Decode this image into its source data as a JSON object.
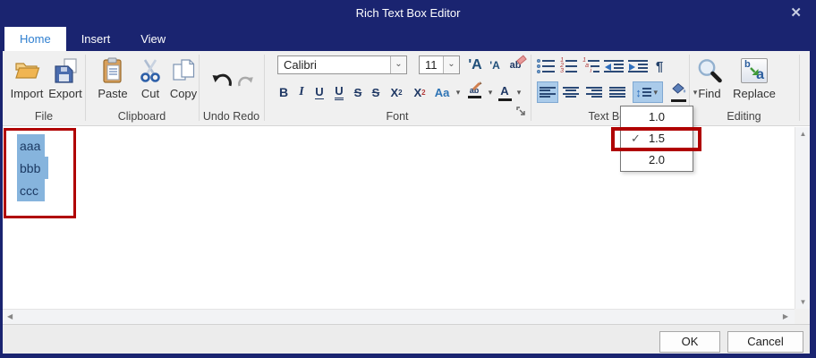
{
  "window": {
    "title": "Rich Text Box Editor"
  },
  "glyphs": {
    "close": "✕",
    "chevron": "⌄",
    "menu_arrow": "▾",
    "check": "✓",
    "up": "▲",
    "down": "▼",
    "left": "◀",
    "right": "▶",
    "updown": "↕",
    "pilcrow": "¶"
  },
  "tabs": {
    "home": "Home",
    "insert": "Insert",
    "view": "View"
  },
  "ribbon": {
    "file": {
      "label": "File",
      "import": "Import",
      "export": "Export"
    },
    "clipboard": {
      "label": "Clipboard",
      "paste": "Paste",
      "cut": "Cut",
      "copy": "Copy"
    },
    "undo_redo": {
      "label": "Undo Redo"
    },
    "font": {
      "label": "Font",
      "family": "Calibri",
      "size": "11",
      "grow": "'A",
      "shrink": "'A",
      "clear": "ab",
      "bold": "B",
      "italic": "I",
      "underline": "U",
      "double_underline": "U",
      "strikethrough": "S",
      "double_strikethrough": "S",
      "sup_base": "X",
      "sup_mark": "2",
      "sub_base": "X",
      "sub_mark": "2",
      "change_case": "Aa",
      "highlight": "ab",
      "font_color": "A"
    },
    "text_box": {
      "label": "Text Box",
      "numbering_marks": [
        "1",
        "2",
        "3"
      ],
      "multilevel_marks": [
        "1",
        "a",
        "i"
      ]
    },
    "editing": {
      "label": "Editing",
      "find": "Find",
      "replace": "Replace",
      "replace_b": "b",
      "replace_a": "a"
    }
  },
  "line_spacing_menu": {
    "items": [
      {
        "label": "1.0",
        "checked": false
      },
      {
        "label": "1.5",
        "checked": true
      },
      {
        "label": "2.0",
        "checked": false
      }
    ]
  },
  "editor": {
    "lines": [
      "aaa",
      "bbb",
      "ccc"
    ]
  },
  "footer": {
    "ok": "OK",
    "cancel": "Cancel"
  },
  "colors": {
    "titlebar": "#1a2470",
    "annotation_red": "#b00000",
    "selection_blue": "#86b4dd",
    "active_tab_text": "#2f7fd0",
    "toggle_active_bg": "#aacbea"
  }
}
